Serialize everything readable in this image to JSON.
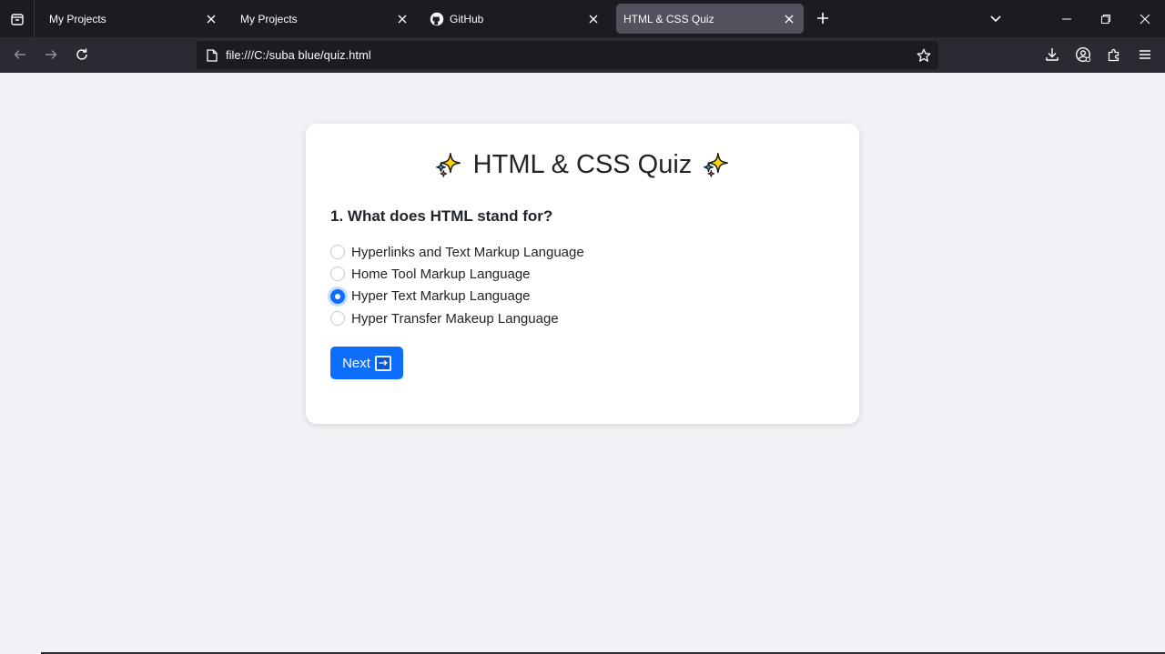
{
  "browser": {
    "tabs": [
      {
        "label": "My Projects",
        "active": false
      },
      {
        "label": "My Projects",
        "active": false
      },
      {
        "label": "GitHub",
        "active": false,
        "icon": "github-icon"
      },
      {
        "label": "HTML & CSS Quiz",
        "active": true
      }
    ],
    "url": "file:///C:/suba blue/quiz.html"
  },
  "quiz": {
    "title": "HTML & CSS Quiz",
    "question": "1. What does HTML stand for?",
    "options": [
      {
        "label": "Hyperlinks and Text Markup Language",
        "checked": false
      },
      {
        "label": "Home Tool Markup Language",
        "checked": false
      },
      {
        "label": "Hyper Text Markup Language",
        "checked": true
      },
      {
        "label": "Hyper Transfer Makeup Language",
        "checked": false
      }
    ],
    "next_label": "Next"
  },
  "colors": {
    "accent": "#0d6efd",
    "page_bg": "#f0f2f6",
    "card_bg": "#ffffff"
  }
}
